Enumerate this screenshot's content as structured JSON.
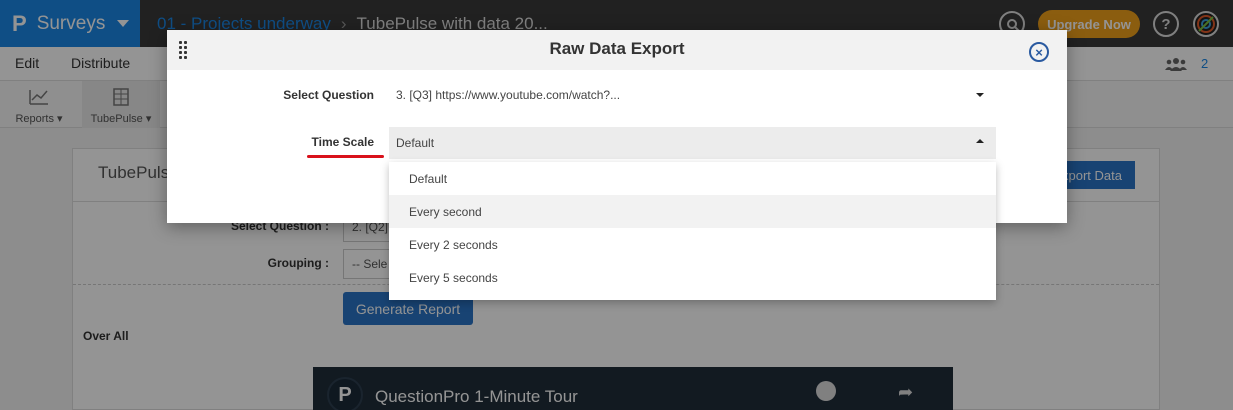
{
  "topbar": {
    "logo": "P",
    "app_name": "Surveys",
    "breadcrumb_folder": "01 - Projects underway",
    "breadcrumb_sep": "›",
    "breadcrumb_survey": "TubePulse with data 20...",
    "upgrade_label": "Upgrade Now",
    "help_label": "?",
    "brand_color": "#1b87e6",
    "upgrade_color": "#f0a01a"
  },
  "menubar": {
    "items": [
      "Edit",
      "Distribute"
    ],
    "users_count": "2"
  },
  "toolbar": {
    "items": [
      {
        "label": "Reports",
        "icon": "chart-icon"
      },
      {
        "label": "TubePulse",
        "icon": "tubepulse-icon"
      }
    ]
  },
  "panel": {
    "title": "TubePuls",
    "export_label": "xport Data",
    "select_question_label": "Select Question :",
    "select_question_value": "2. [Q2]",
    "grouping_label": "Grouping :",
    "grouping_value": "-- Sele",
    "generate_label": "Generate Report",
    "overall_label": "Over All",
    "video_logo": "P",
    "video_title": "QuestionPro 1-Minute Tour"
  },
  "modal": {
    "title": "Raw Data Export",
    "close_label": "×",
    "fields": {
      "question_label": "Select Question",
      "question_value": "3. [Q3] https://www.youtube.com/watch?...",
      "timescale_label": "Time Scale",
      "timescale_value": "Default"
    },
    "timescale_options": [
      "Default",
      "Every second",
      "Every 2 seconds",
      "Every 5 seconds"
    ],
    "highlight_color": "#d9111b"
  }
}
